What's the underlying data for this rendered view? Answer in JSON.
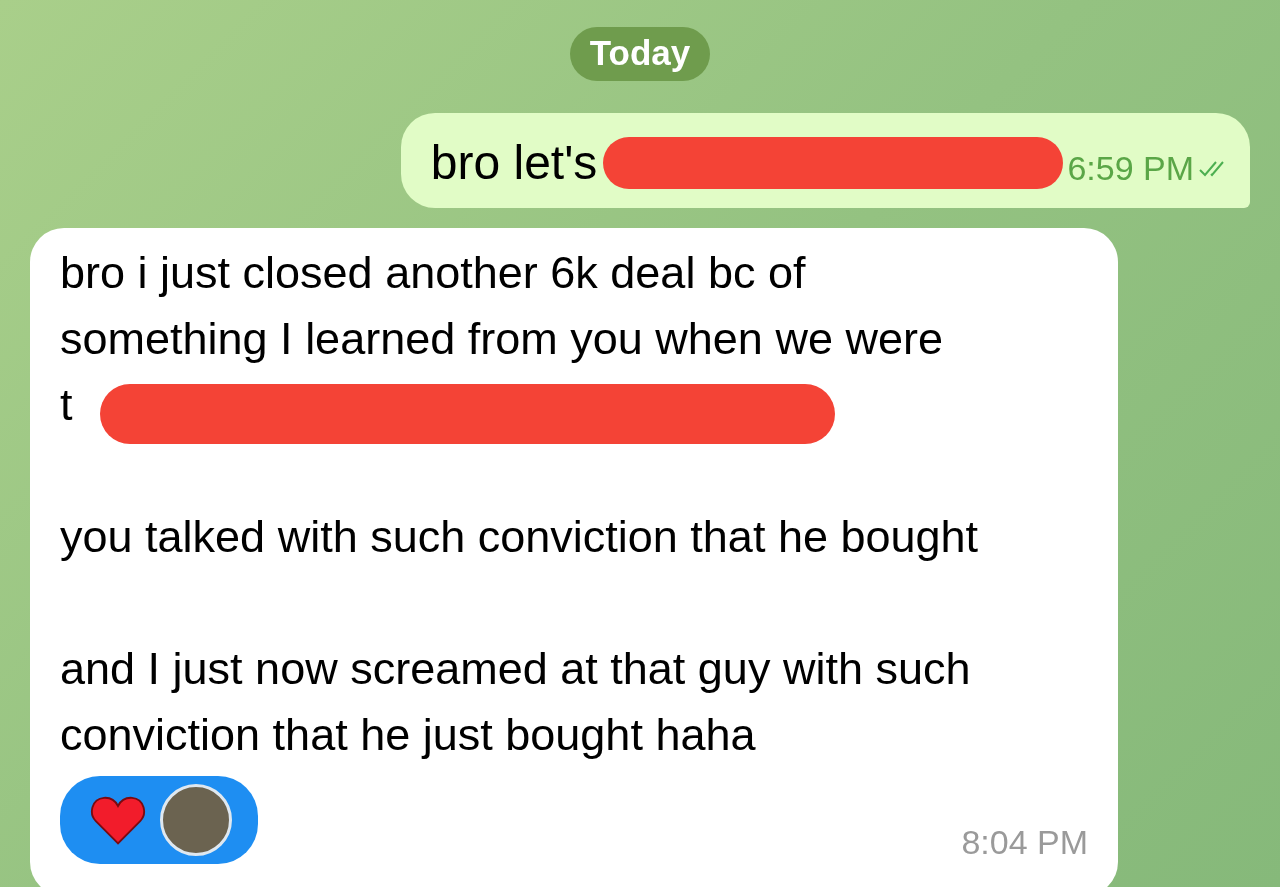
{
  "date_label": "Today",
  "messages": [
    {
      "kind": "outgoing",
      "paragraphs": [
        {
          "text": "bro let's",
          "redacted": true
        }
      ],
      "time": "6:59 PM",
      "read": true
    },
    {
      "kind": "incoming",
      "paragraphs": [
        {
          "text": "bro i just closed another 6k deal bc of something I learned from you when we were t",
          "redacted": true
        },
        {
          "text": "you talked with such conviction that he bought",
          "redacted": false
        },
        {
          "text": "and I just now screamed at that guy with such conviction that he just bought haha",
          "redacted": false
        }
      ],
      "reactions": [
        {
          "kind": "heart"
        }
      ],
      "time": "8:04 PM"
    }
  ]
}
